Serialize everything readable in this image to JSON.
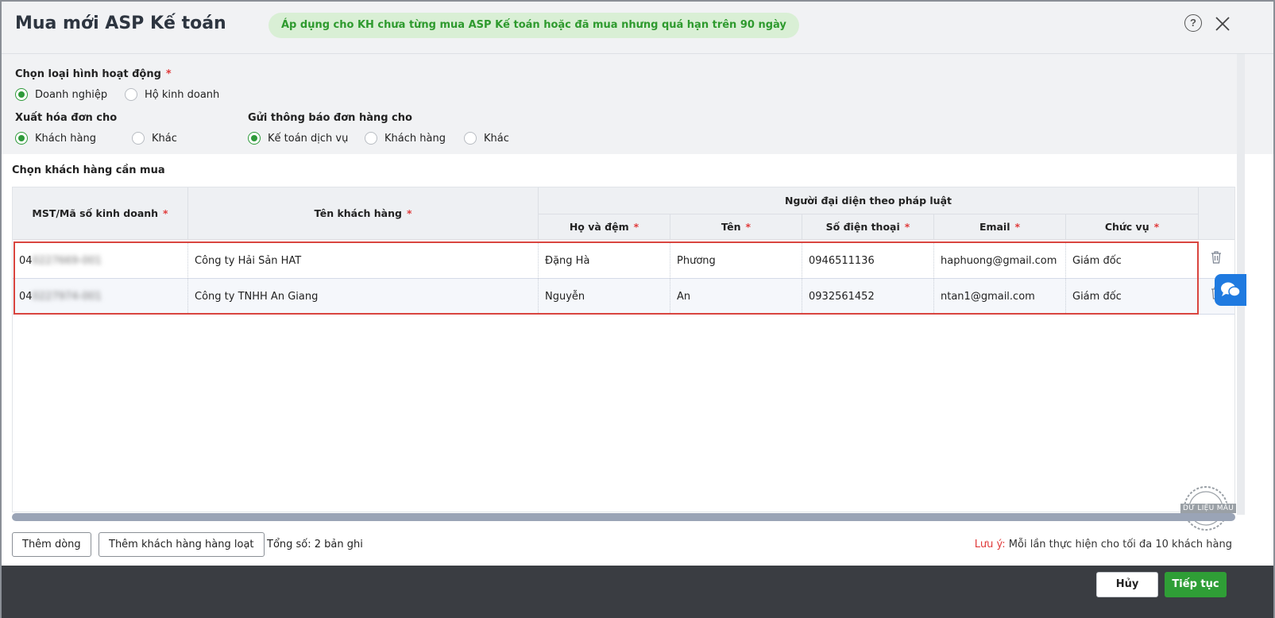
{
  "header": {
    "title": "Mua mới ASP Kế toán",
    "notice": "Áp dụng cho KH chưa từng mua ASP Kế toán hoặc đã mua nhưng quá hạn trên 90 ngày",
    "help_glyph": "?"
  },
  "options": {
    "business_type": {
      "label": "Chọn loại hình hoạt động",
      "required_mark": "*",
      "choices": [
        "Doanh nghiệp",
        "Hộ kinh doanh"
      ],
      "selected": "Doanh nghiệp"
    },
    "invoice_for": {
      "label": "Xuất hóa đơn cho",
      "choices": [
        "Khách hàng",
        "Khác"
      ],
      "selected": "Khách hàng"
    },
    "notify_to": {
      "label": "Gửi thông báo đơn hàng cho",
      "choices": [
        "Kế toán dịch vụ",
        "Khách hàng",
        "Khác"
      ],
      "selected": "Kế toán dịch vụ"
    }
  },
  "table": {
    "section_title": "Chọn khách hàng cần mua",
    "group_header": "Người đại diện theo pháp luật",
    "required_mark": "*",
    "columns": [
      "MST/Mã số kinh doanh",
      "Tên khách hàng",
      "Họ và đệm",
      "Tên",
      "Số điện thoại",
      "Email",
      "Chức vụ"
    ],
    "rows": [
      {
        "tax_prefix": "04",
        "tax_hidden": "0227669-001",
        "name": "Công ty Hải Sản HAT",
        "last_middle": "Đặng Hà",
        "first": "Phương",
        "phone": "0946511136",
        "email": "haphuong@gmail.com",
        "position": "Giám đốc"
      },
      {
        "tax_prefix": "04",
        "tax_hidden": "0227974-001",
        "name": "Công ty TNHH An Giang",
        "last_middle": "Nguyễn",
        "first": "An",
        "phone": "0932561452",
        "email": "ntan1@gmail.com",
        "position": "Giám đốc"
      }
    ]
  },
  "stamp": {
    "text": "DỮ LIỆU MẪU"
  },
  "footer": {
    "add_row": "Thêm dòng",
    "add_bulk": "Thêm khách hàng hàng loạt",
    "total": "Tổng số: 2 bản ghi",
    "note_label": "Lưu ý:",
    "note_text": " Mỗi lần thực hiện cho tối đa 10 khách hàng",
    "cancel": "Hủy",
    "continue": "Tiếp tục"
  },
  "colors": {
    "accent_green": "#2e9a3a",
    "notice_bg": "#d9efd5",
    "highlight_red": "#d9453f",
    "chat_blue": "#1f7ae0"
  }
}
